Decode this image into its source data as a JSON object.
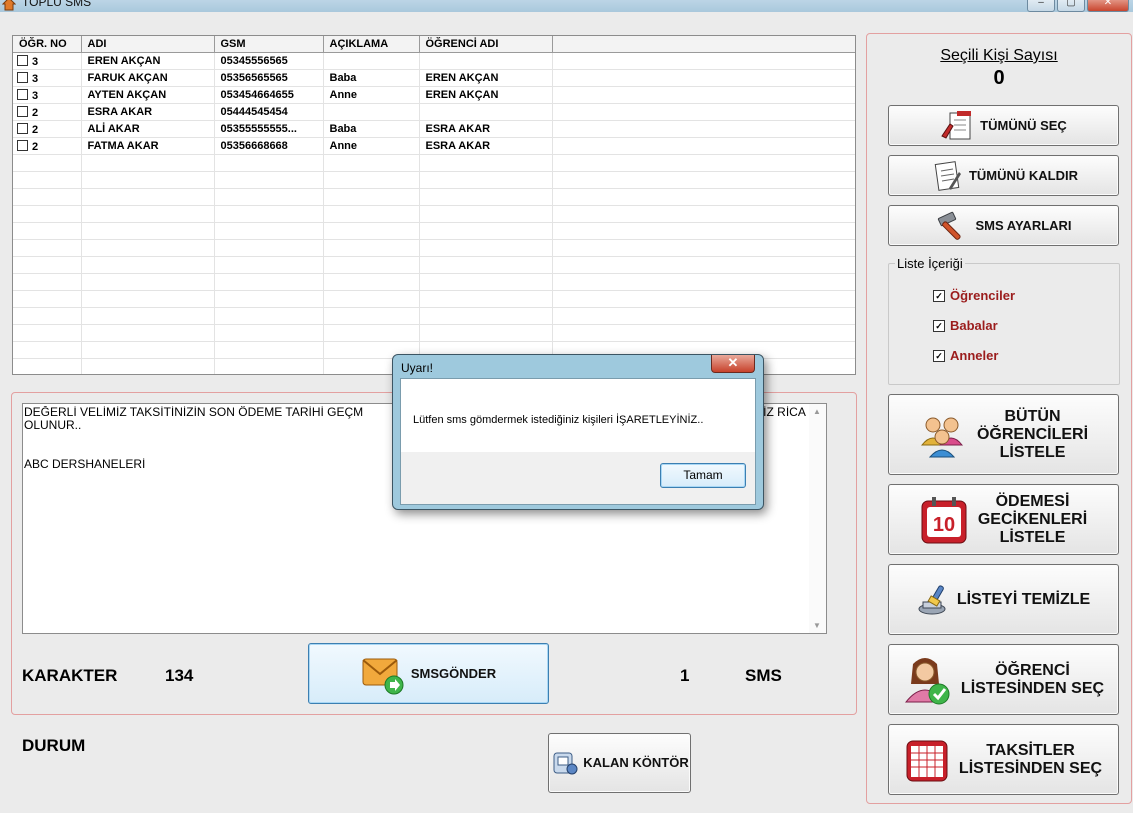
{
  "window": {
    "title": "TOPLU SMS"
  },
  "grid": {
    "columns": [
      "ÖĞR. NO",
      "ADI",
      "GSM",
      "AÇIKLAMA",
      "ÖĞRENCİ ADI"
    ],
    "rows": [
      {
        "no": "3",
        "name": "EREN  AKÇAN",
        "gsm": "05345556565",
        "desc": "",
        "student": ""
      },
      {
        "no": "3",
        "name": "FARUK AKÇAN",
        "gsm": "05356565565",
        "desc": "Baba",
        "student": "EREN  AKÇAN"
      },
      {
        "no": "3",
        "name": "AYTEN AKÇAN",
        "gsm": "053454664655",
        "desc": "Anne",
        "student": "EREN  AKÇAN"
      },
      {
        "no": "2",
        "name": "ESRA AKAR",
        "gsm": "05444545454",
        "desc": "",
        "student": ""
      },
      {
        "no": "2",
        "name": "ALİ AKAR",
        "gsm": "05355555555...",
        "desc": "Baba",
        "student": "ESRA AKAR"
      },
      {
        "no": "2",
        "name": "FATMA AKAR",
        "gsm": "05356668668",
        "desc": "Anne",
        "student": "ESRA AKAR"
      }
    ]
  },
  "message": {
    "line1_left": "DEĞERLİ VELİMİZ TAKSİTİNİZİN SON ÖDEME TARİHİ GEÇM",
    "line1_right": "İZ RİCA",
    "line2": "OLUNUR..",
    "line3": "",
    "line4": "ABC DERSHANELERİ"
  },
  "footer": {
    "char_label": "KARAKTER",
    "char_count": "134",
    "send_label": "SMSGÖNDER",
    "sms_count": "1",
    "sms_label": "SMS",
    "status_label": "DURUM",
    "credit_label": "KALAN KÖNTÖR"
  },
  "right": {
    "selected_title": "Seçili Kişi Sayısı",
    "selected_count": "0",
    "select_all": "TÜMÜNÜ SEÇ",
    "deselect_all": "TÜMÜNÜ KALDIR",
    "sms_settings": "SMS AYARLARI",
    "list_group_title": "Liste İçeriği",
    "filters": [
      {
        "label": "Öğrenciler",
        "checked": true
      },
      {
        "label": "Babalar",
        "checked": true
      },
      {
        "label": "Anneler",
        "checked": true
      }
    ],
    "list_all": [
      "BÜTÜN",
      "ÖĞRENCİLERİ",
      "LİSTELE"
    ],
    "list_overdue": [
      "ÖDEMESİ",
      "GECİKENLERİ",
      "LİSTELE"
    ],
    "clear_list": "LİSTEYİ TEMİZLE",
    "select_from_students": [
      "ÖĞRENCİ",
      "LİSTESİNDEN SEÇ"
    ],
    "select_from_installments": [
      "TAKSİTLER",
      "LİSTESİNDEN SEÇ"
    ],
    "calendar_number": "10"
  },
  "dialog": {
    "title": "Uyarı!",
    "message": "Lütfen sms gömdermek istediğiniz kişileri İŞARETLEYİNİZ..",
    "ok": "Tamam",
    "close": "✕"
  },
  "colors": {
    "accent_red": "#9b1c1c",
    "panel_border": "#e3a0a0",
    "dialog_frame": "#9ec9dd"
  }
}
